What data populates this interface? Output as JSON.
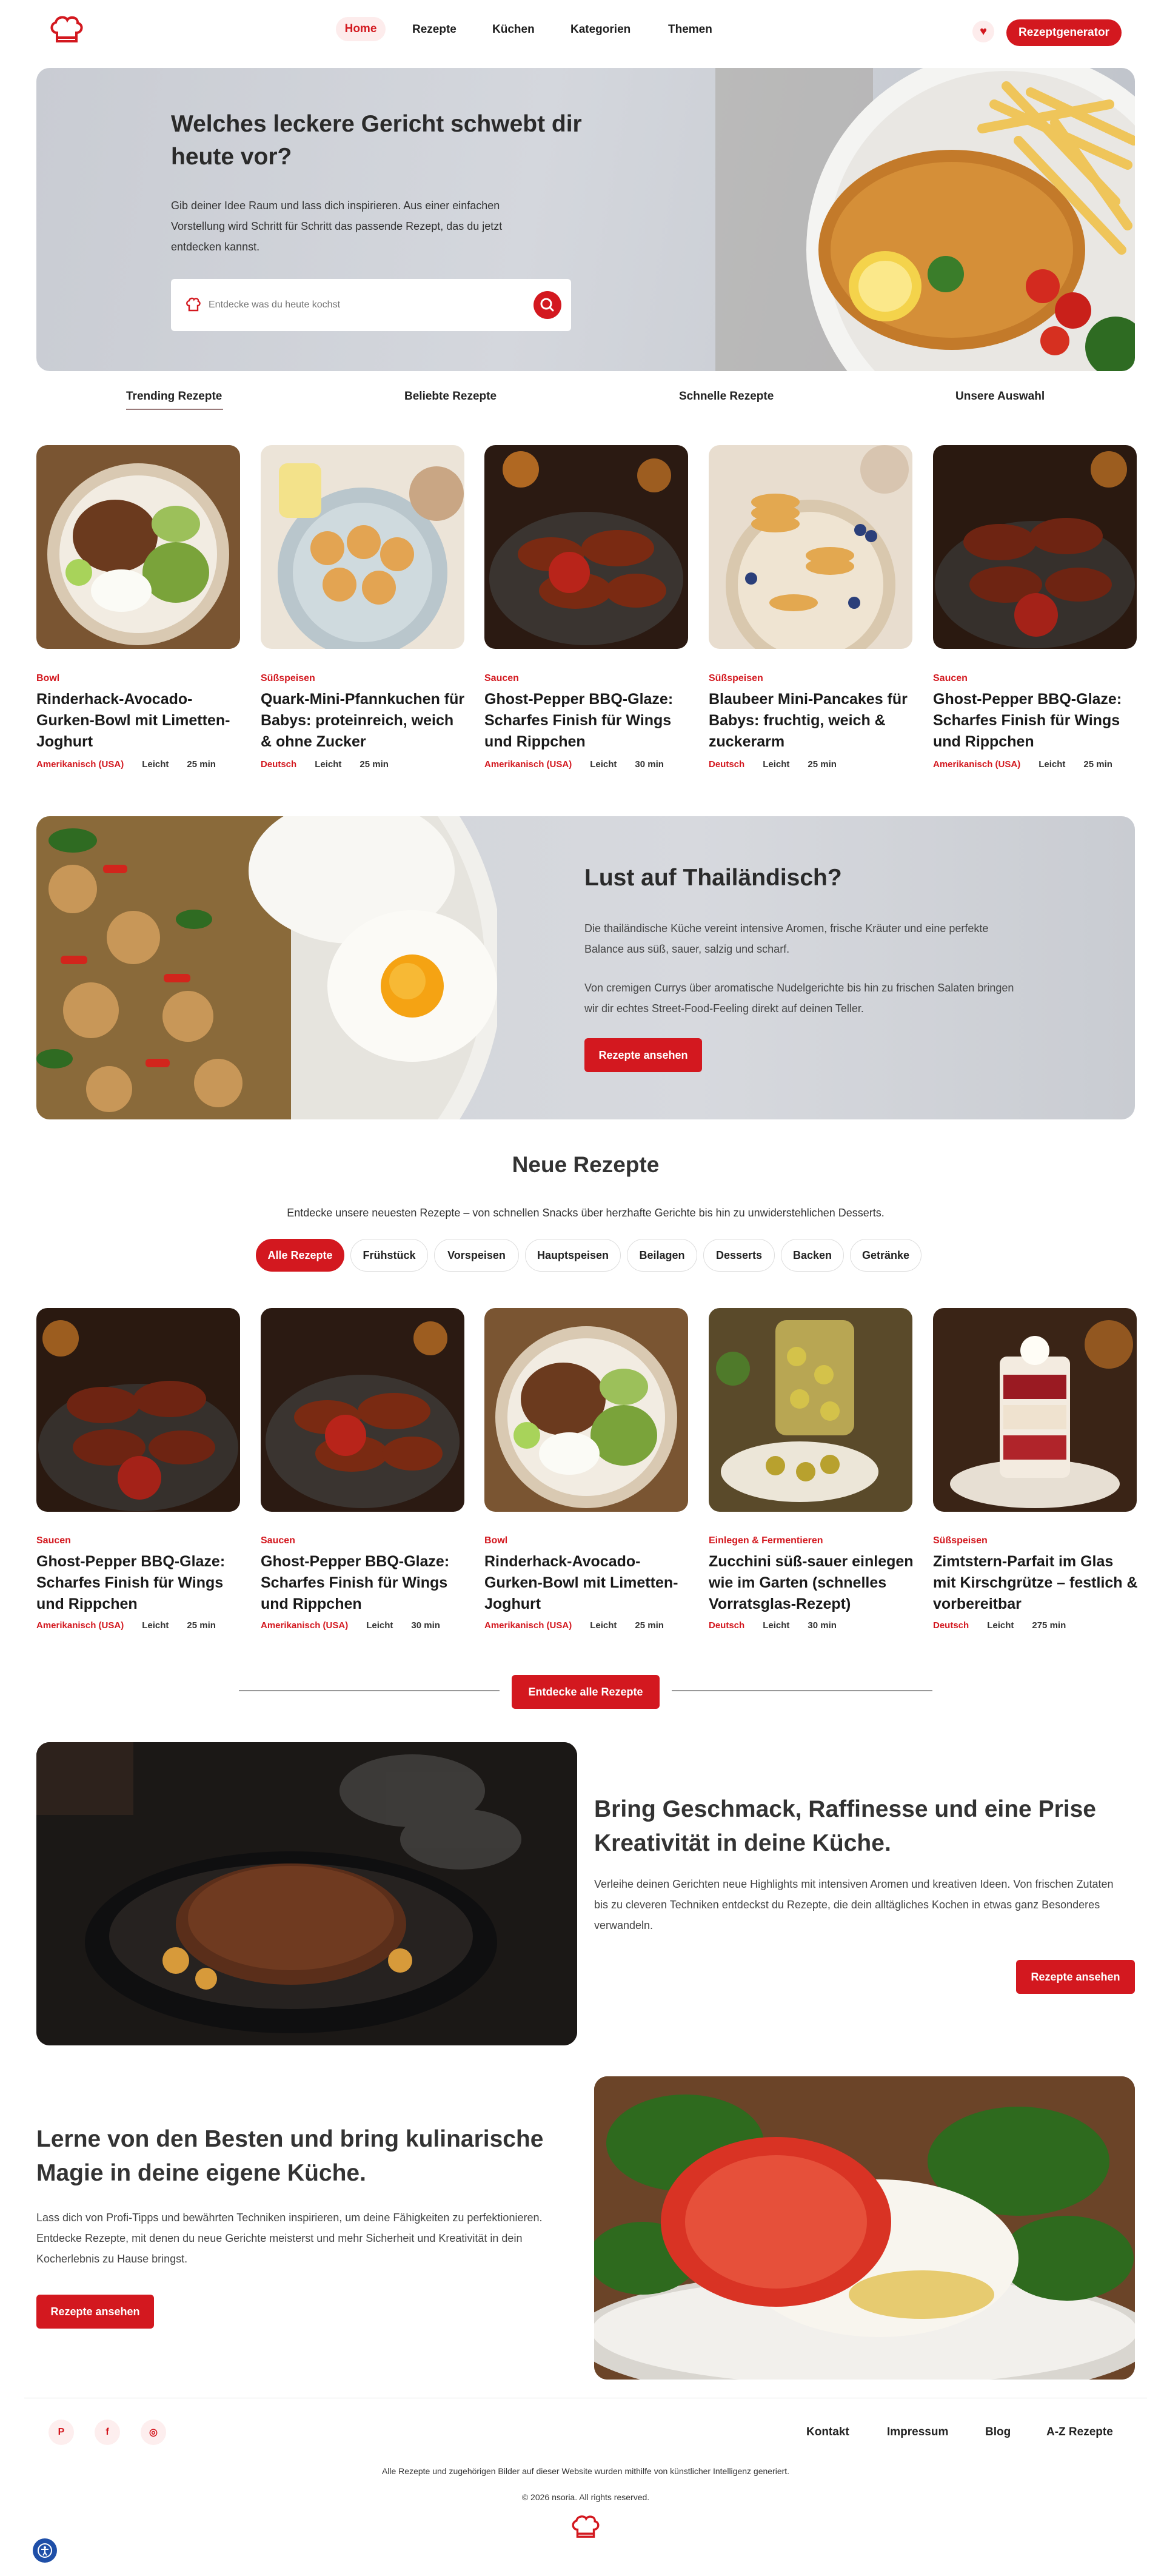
{
  "header": {
    "nav": [
      "Home",
      "Rezepte",
      "Küchen",
      "Kategorien",
      "Themen"
    ],
    "cta": "Rezeptgenerator"
  },
  "hero": {
    "title": "Welches leckere Gericht schwebt dir heute vor?",
    "text": "Gib deiner Idee Raum und lass dich inspirieren. Aus einer einfachen Vorstellung wird Schritt für Schritt das passende Rezept, das du jetzt entdecken kannst.",
    "search_placeholder": "Entdecke was du heute kochst"
  },
  "tabs": [
    "Trending Rezepte",
    "Beliebte Rezepte",
    "Schnelle Rezepte",
    "Unsere Auswahl"
  ],
  "trending": [
    {
      "category": "Bowl",
      "title": "Rinderhack-Avocado-Gurken-Bowl mit Limetten-Joghurt",
      "origin": "Amerikanisch (USA)",
      "difficulty": "Leicht",
      "time": "25 min"
    },
    {
      "category": "Süßspeisen",
      "title": "Quark-Mini-Pfannkuchen für Babys: proteinreich, weich & ohne Zucker",
      "origin": "Deutsch",
      "difficulty": "Leicht",
      "time": "25 min"
    },
    {
      "category": "Saucen",
      "title": "Ghost-Pepper BBQ-Glaze: Scharfes Finish für Wings und Rippchen",
      "origin": "Amerikanisch (USA)",
      "difficulty": "Leicht",
      "time": "30 min"
    },
    {
      "category": "Süßspeisen",
      "title": "Blaubeer Mini-Pancakes für Babys: fruchtig, weich & zuckerarm",
      "origin": "Deutsch",
      "difficulty": "Leicht",
      "time": "25 min"
    },
    {
      "category": "Saucen",
      "title": "Ghost-Pepper BBQ-Glaze: Scharfes Finish für Wings und Rippchen",
      "origin": "Amerikanisch (USA)",
      "difficulty": "Leicht",
      "time": "25 min"
    }
  ],
  "thai": {
    "title": "Lust auf Thailändisch?",
    "p1": "Die thailändische Küche vereint intensive Aromen, frische Kräuter und eine perfekte Balance aus süß, sauer, salzig und scharf.",
    "p2": "Von cremigen Currys über aromatische Nudelgerichte bis hin zu frischen Salaten bringen wir dir echtes Street-Food-Feeling direkt auf deinen Teller.",
    "button": "Rezepte ansehen"
  },
  "neue": {
    "title": "Neue Rezepte",
    "subtitle": "Entdecke unsere neuesten Rezepte – von schnellen Snacks über herzhafte Gerichte bis hin zu unwiderstehlichen Desserts.",
    "filters": [
      "Alle Rezepte",
      "Frühstück",
      "Vorspeisen",
      "Hauptspeisen",
      "Beilagen",
      "Desserts",
      "Backen",
      "Getränke"
    ],
    "cards": [
      {
        "category": "Saucen",
        "title": "Ghost-Pepper BBQ-Glaze: Scharfes Finish für Wings und Rippchen",
        "origin": "Amerikanisch (USA)",
        "difficulty": "Leicht",
        "time": "25 min"
      },
      {
        "category": "Saucen",
        "title": "Ghost-Pepper BBQ-Glaze: Scharfes Finish für Wings und Rippchen",
        "origin": "Amerikanisch (USA)",
        "difficulty": "Leicht",
        "time": "30 min"
      },
      {
        "category": "Bowl",
        "title": "Rinderhack-Avocado-Gurken-Bowl mit Limetten-Joghurt",
        "origin": "Amerikanisch (USA)",
        "difficulty": "Leicht",
        "time": "25 min"
      },
      {
        "category": "Einlegen & Fermentieren",
        "title": "Zucchini süß-sauer einlegen wie im Garten (schnelles Vorratsglas-Rezept)",
        "origin": "Deutsch",
        "difficulty": "Leicht",
        "time": "30 min"
      },
      {
        "category": "Süßspeisen",
        "title": "Zimtstern-Parfait im Glas mit Kirschgrütze – festlich & vorbereitbar",
        "origin": "Deutsch",
        "difficulty": "Leicht",
        "time": "275 min"
      }
    ],
    "all_button": "Entdecke alle Rezepte"
  },
  "promo1": {
    "title": "Bring Geschmack, Raffinesse und eine Prise Kreativität in deine Küche.",
    "text": "Verleihe deinen Gerichten neue Highlights mit intensiven Aromen und kreativen Ideen. Von frischen Zutaten bis zu cleveren Techniken entdeckst du Rezepte, die dein alltägliches Kochen in etwas ganz Besonderes verwandeln.",
    "button": "Rezepte ansehen"
  },
  "promo2": {
    "title": "Lerne von den Besten und bring kulinarische Magie in deine eigene Küche.",
    "text": "Lass dich von Profi-Tipps und bewährten Techniken inspirieren, um deine Fähigkeiten zu perfektionieren. Entdecke Rezepte, mit denen du neue Gerichte meisterst und mehr Sicherheit und Kreativität in dein Kocherlebnis zu Hause bringst.",
    "button": "Rezepte ansehen"
  },
  "footer": {
    "links": [
      "Kontakt",
      "Impressum",
      "Blog",
      "A-Z Rezepte"
    ],
    "social": [
      "P",
      "f",
      "◎"
    ],
    "disclaimer": "Alle Rezepte und zugehörigen Bilder auf dieser Website wurden mithilfe von künstlicher Intelligenz generiert.",
    "copyright": "© 2026 nsoria. All rights reserved."
  },
  "colors": {
    "accent": "#d3181f"
  }
}
